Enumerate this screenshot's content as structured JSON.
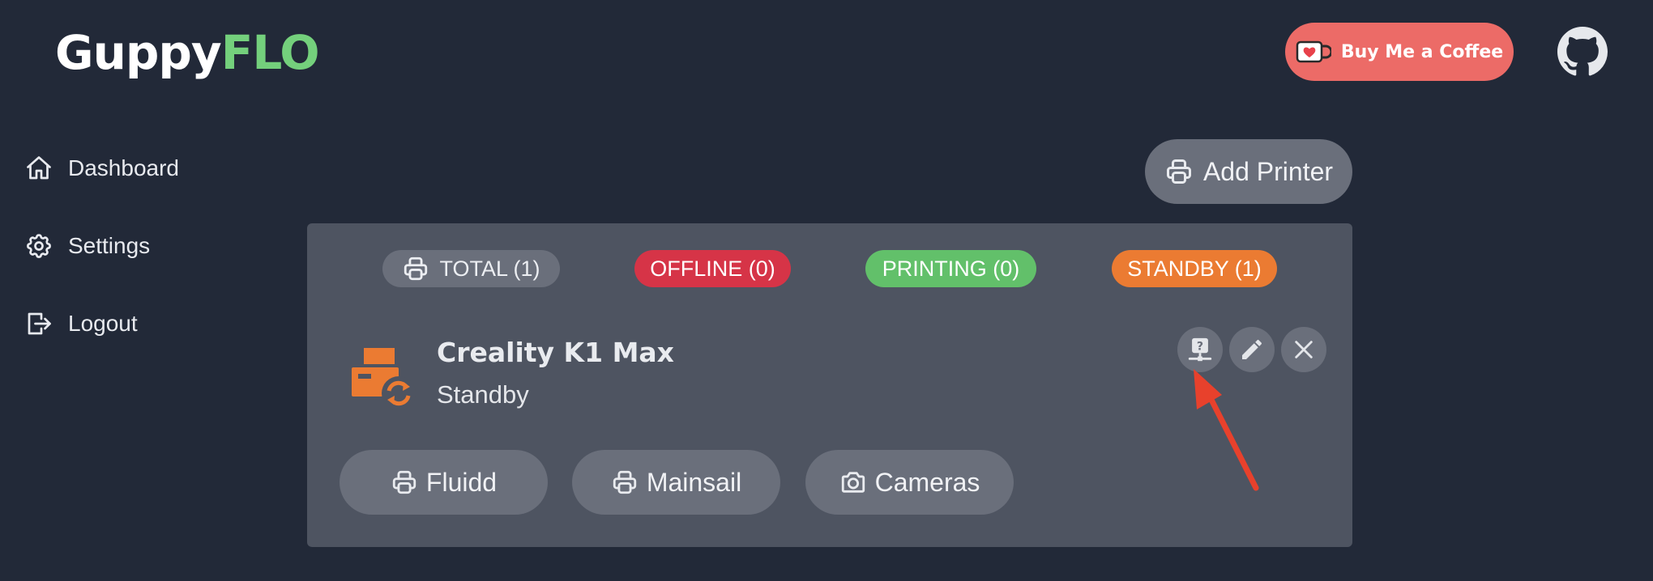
{
  "header": {
    "logo_part1": "Guppy",
    "logo_part2": "FLO",
    "coffee_label": "Buy Me a Coffee",
    "github_icon": "github-icon"
  },
  "sidebar": {
    "items": [
      {
        "label": "Dashboard",
        "icon": "home-icon"
      },
      {
        "label": "Settings",
        "icon": "gear-icon"
      },
      {
        "label": "Logout",
        "icon": "logout-icon"
      }
    ]
  },
  "toolbar": {
    "add_printer_label": "Add Printer"
  },
  "filters": {
    "total": "TOTAL (1)",
    "offline": "OFFLINE (0)",
    "printing": "PRINTING (0)",
    "standby": "STANDBY (1)"
  },
  "printer": {
    "name": "Creality K1 Max",
    "status": "Standby",
    "status_icon": "printer-sync-icon",
    "actions": [
      "unknown-status-icon",
      "pencil-icon",
      "close-icon"
    ],
    "links": [
      {
        "label": "Fluidd",
        "icon": "printer-icon"
      },
      {
        "label": "Mainsail",
        "icon": "printer-icon"
      },
      {
        "label": "Cameras",
        "icon": "camera-icon"
      }
    ]
  },
  "colors": {
    "background": "#222938",
    "panel": "#4e5461",
    "button": "#6a6f7b",
    "brand_green": "#74d07c",
    "coffee": "#ec6b67",
    "offline": "#d63447",
    "printing": "#62c06a",
    "standby": "#eb7b32",
    "annotation_arrow": "#e8412c"
  }
}
